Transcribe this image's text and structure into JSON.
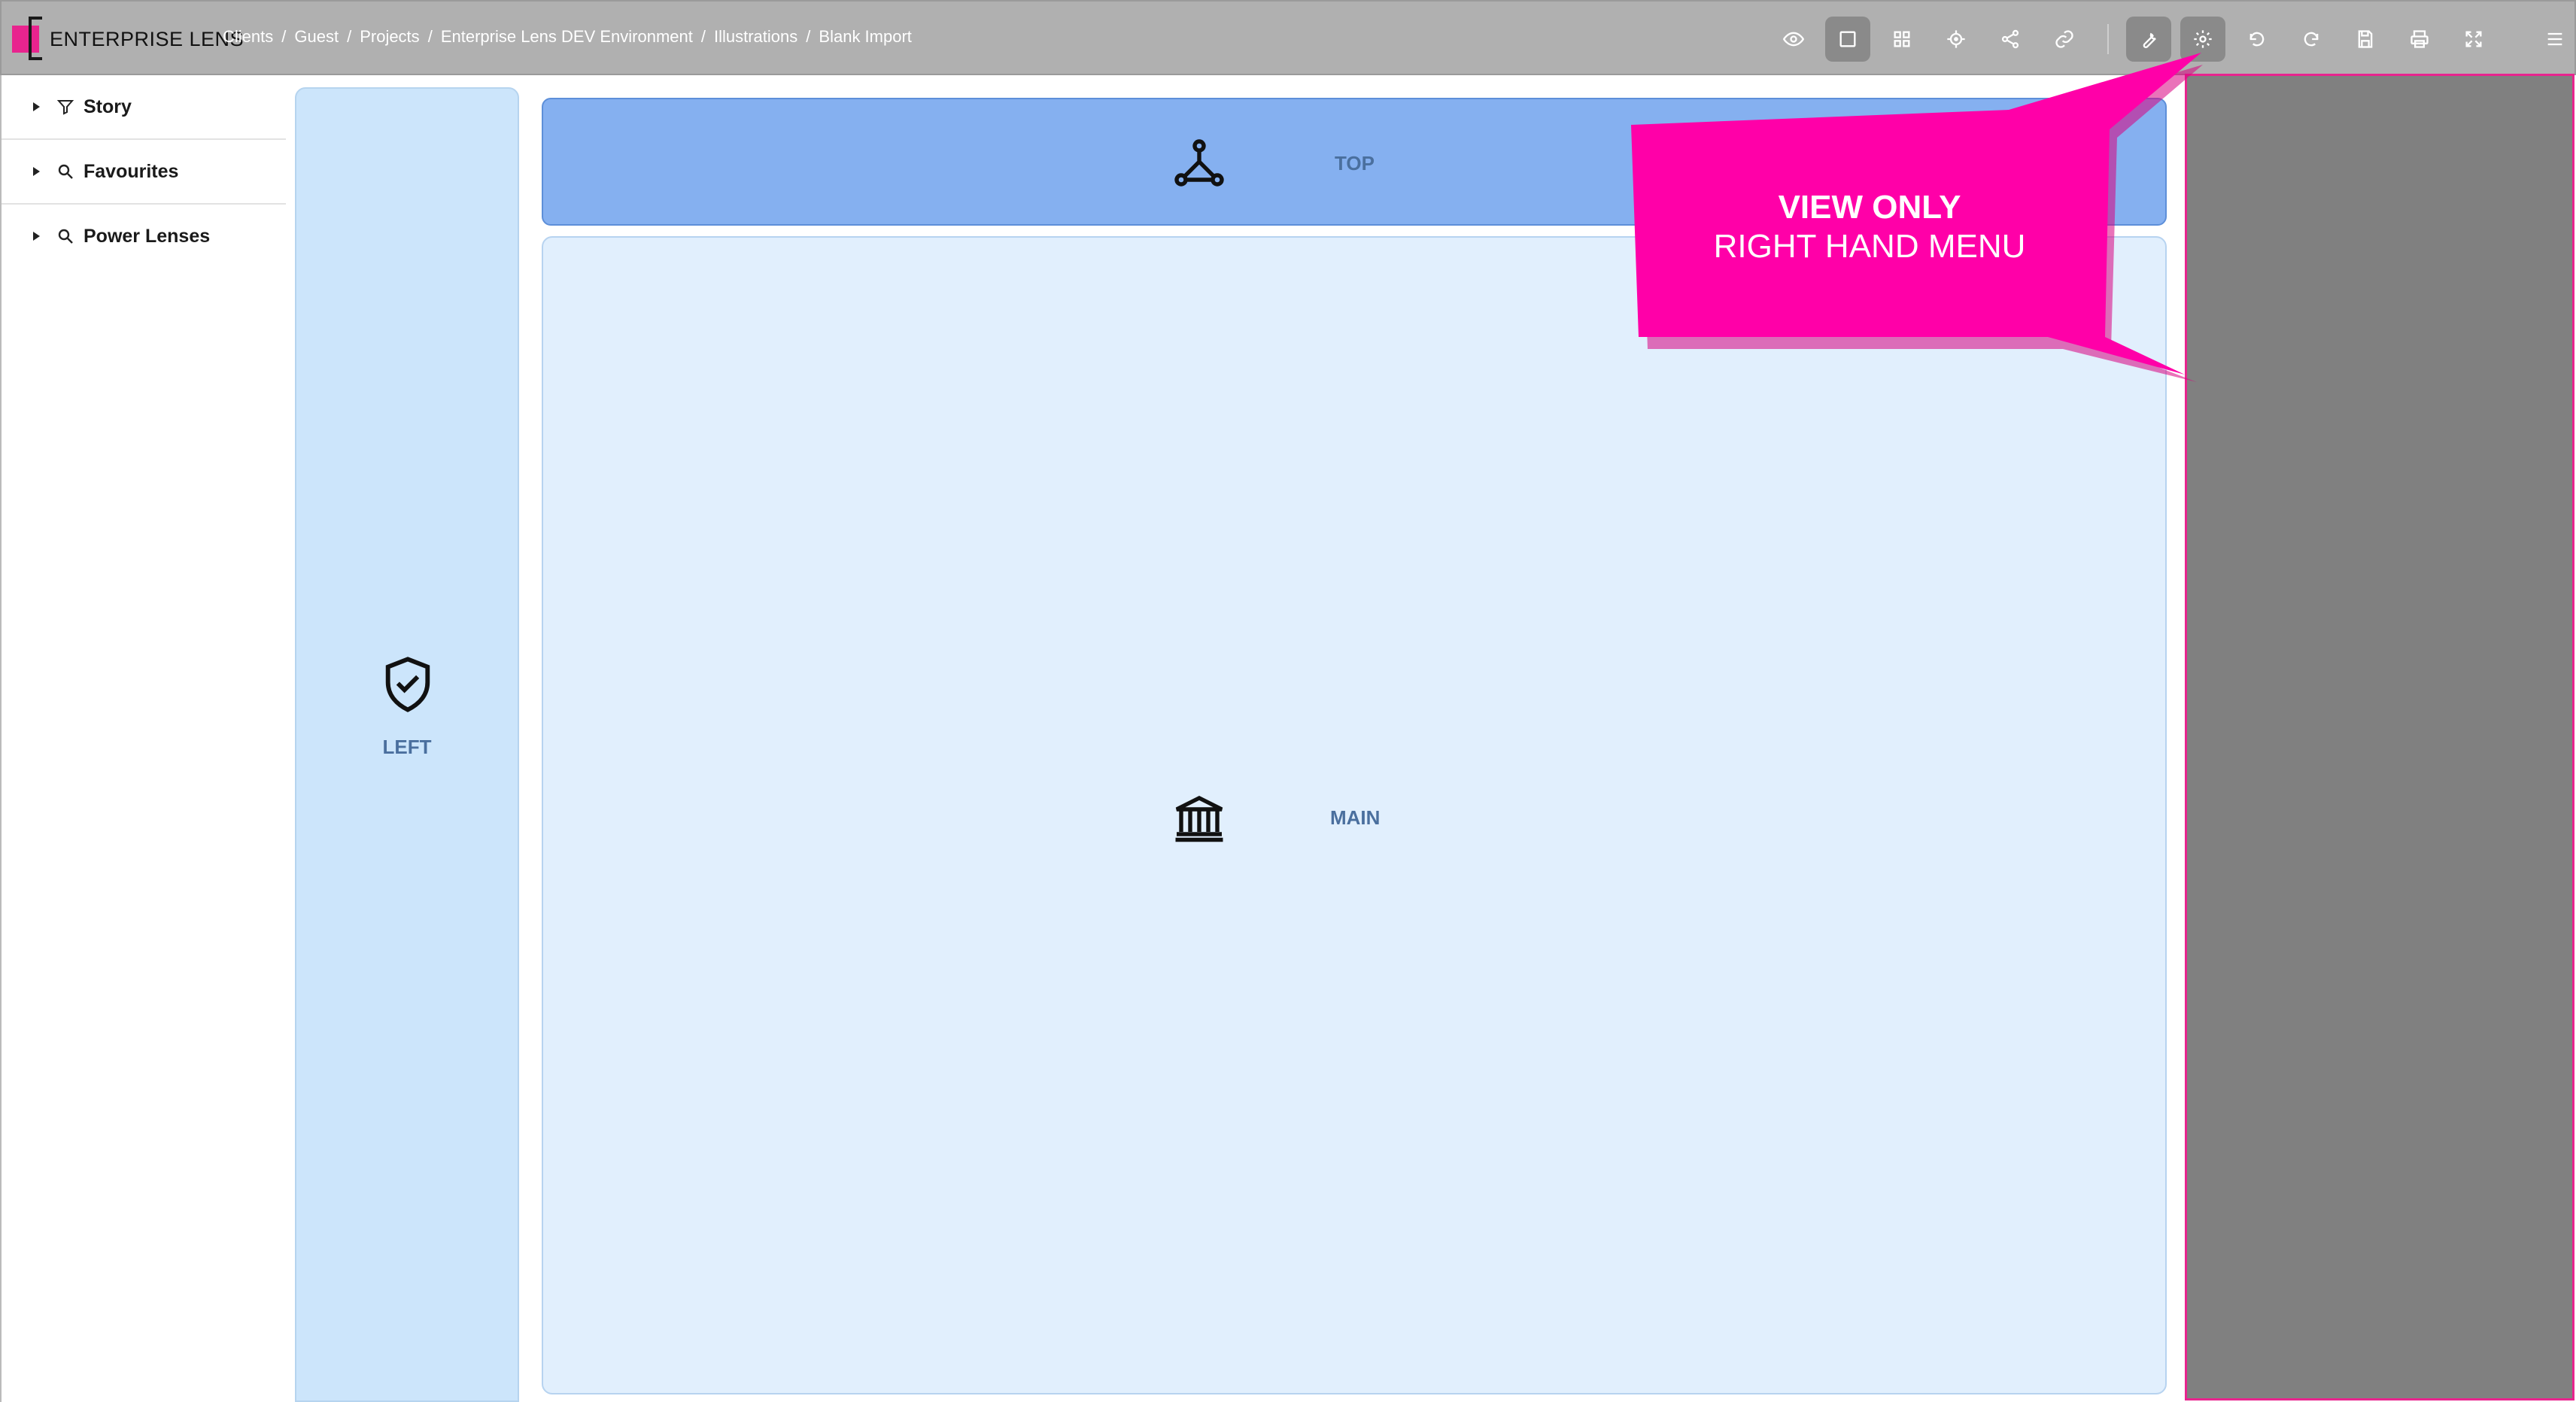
{
  "app": {
    "logo_text": "ENTERPRISE LENS"
  },
  "breadcrumb": [
    "Clients",
    "Guest",
    "Projects",
    "Enterprise Lens DEV Environment",
    "Illustrations",
    "Blank Import"
  ],
  "breadcrumb_separator": "/",
  "toolbar": {
    "icons": [
      "eye-icon",
      "square-icon",
      "grid-icon",
      "target-icon",
      "share-icon",
      "link-icon",
      "wrench-icon",
      "gear-icon",
      "undo-icon",
      "redo-icon",
      "save-icon",
      "print-icon",
      "fullscreen-icon",
      "menu-icon"
    ],
    "active": [
      "square-icon",
      "wrench-icon",
      "gear-icon"
    ]
  },
  "sidebar": {
    "items": [
      {
        "label": "Story",
        "icon": "filter-icon"
      },
      {
        "label": "Favourites",
        "icon": "search-icon"
      },
      {
        "label": "Power Lenses",
        "icon": "search-icon"
      }
    ]
  },
  "regions": {
    "left": {
      "label": "LEFT",
      "icon": "shield-check-icon"
    },
    "top": {
      "label": "TOP",
      "icon": "network-icon"
    },
    "main": {
      "label": "MAIN",
      "icon": "bank-icon"
    }
  },
  "callout": {
    "title": "VIEW ONLY",
    "subtitle": "RIGHT HAND MENU"
  },
  "colors": {
    "accent": "#e8248e",
    "topbar": "#b0b0b0",
    "left_region": "#cce5fb",
    "top_region": "#85b0f0",
    "main_region": "#e1effd",
    "right_panel": "#808080"
  }
}
